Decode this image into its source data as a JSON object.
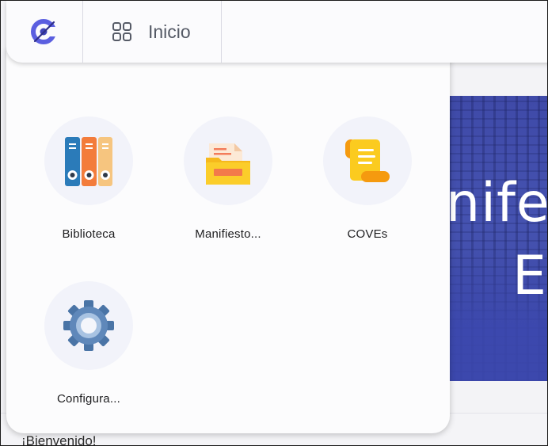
{
  "navbar": {
    "home_label": "Inicio"
  },
  "apps": [
    {
      "label": "Biblioteca",
      "icon": "binders-icon"
    },
    {
      "label": "Manifiesto...",
      "icon": "folder-documents-icon"
    },
    {
      "label": "COVEs",
      "icon": "scroll-icon"
    },
    {
      "label": "Configura...",
      "icon": "gear-icon"
    }
  ],
  "hero": {
    "line1": "nifes",
    "line2": "E"
  },
  "main": {
    "welcome": "¡Bienvenido!"
  },
  "colors": {
    "brand": "#5b5fe0",
    "hero": "#4552b0"
  }
}
